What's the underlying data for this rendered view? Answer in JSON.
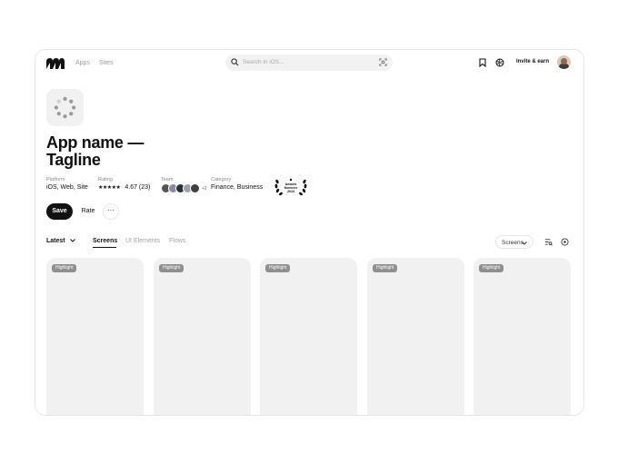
{
  "header": {
    "nav": [
      "Apps",
      "Sites"
    ],
    "search_placeholder": "Search in iOS...",
    "invite_label": "Invite & earn"
  },
  "app": {
    "title": "App name — Tagline",
    "platform_label": "Platform",
    "platform_value": "iOS, Web, Site",
    "rating_label": "Rating",
    "rating_stars": "★★★★★",
    "rating_value": "4.67 (23)",
    "team_label": "Team",
    "team_more": "+2",
    "category_label": "Category",
    "category_value": "Finance, Business",
    "award_lines": [
      "Awards",
      "Nominee",
      "2024"
    ]
  },
  "actions": {
    "save": "Save",
    "rate": "Rate",
    "more": "···"
  },
  "toolbar": {
    "sort": "Latest",
    "tabs": [
      "Screens",
      "UI Elements",
      "Flows"
    ],
    "active_tab": "Screens",
    "view_select": "Screens"
  },
  "cards": [
    {
      "badge": "Highlight"
    },
    {
      "badge": "Highlight"
    },
    {
      "badge": "Highlight"
    },
    {
      "badge": "Highlight"
    },
    {
      "badge": "Highlight"
    }
  ],
  "colors": {
    "accent": "#111111",
    "card_bg": "#f1f1f1",
    "badge_bg": "#8f8f8f"
  }
}
